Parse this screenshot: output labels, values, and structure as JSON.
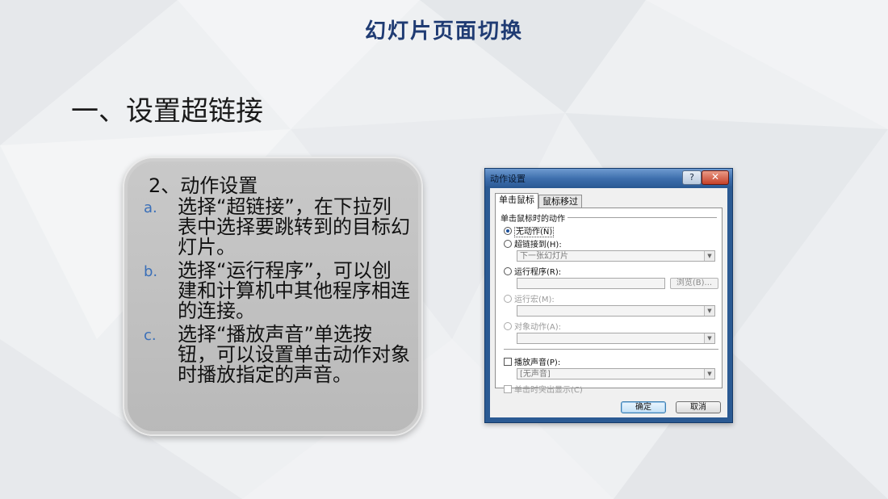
{
  "slide": {
    "title": "幻灯片页面切换",
    "section_heading": "一、设置超链接"
  },
  "card": {
    "title": "2、动作设置",
    "items": [
      {
        "marker": "a.",
        "text": "选择“超链接”，在下拉列表中选择要跳转到的目标幻灯片。"
      },
      {
        "marker": "b.",
        "text": "选择“运行程序”，可以创建和计算机中其他程序相连的连接。"
      },
      {
        "marker": "c.",
        "text": "选择“播放声音”单选按钮，可以设置单击动作对象时播放指定的声音。"
      }
    ]
  },
  "dialog": {
    "title": "动作设置",
    "help_label": "?",
    "close_label": "✕",
    "tabs": [
      {
        "label": "单击鼠标",
        "active": true
      },
      {
        "label": "鼠标移过",
        "active": false
      }
    ],
    "group_label": "单击鼠标时的动作",
    "options": {
      "none": "无动作(N)",
      "hyperlink": "超链接到(H):",
      "hyperlink_value": "下一张幻灯片",
      "run_program": "运行程序(R):",
      "browse": "浏览(B)...",
      "run_macro": "运行宏(M):",
      "object_action": "对象动作(A):"
    },
    "play_sound": "播放声音(P):",
    "sound_value": "[无声音]",
    "highlight_click": "单击时突出显示(C)",
    "ok": "确定",
    "cancel": "取消"
  },
  "colors": {
    "title": "#1f3b73",
    "marker": "#3a6fb8",
    "card_bg": "#c2c2c2",
    "dialog_frame": "#2b5a93"
  }
}
